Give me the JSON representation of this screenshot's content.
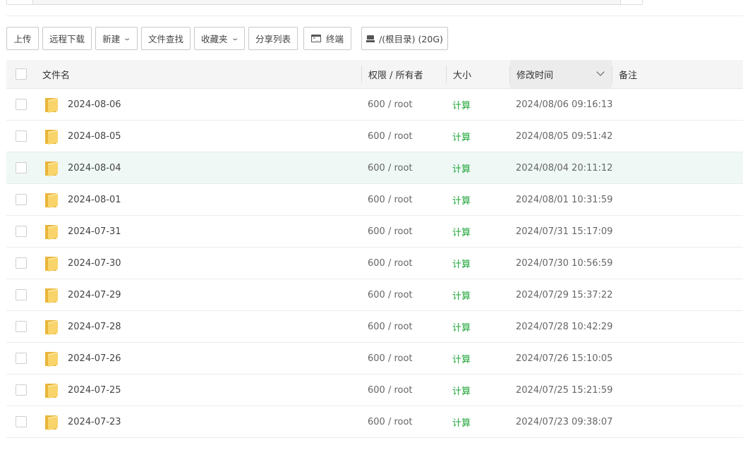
{
  "toolbar": {
    "upload": "上传",
    "remote_download": "远程下载",
    "new": "新建",
    "file_search": "文件查找",
    "favorites": "收藏夹",
    "share_list": "分享列表",
    "terminal": "终端",
    "disk": "/(根目录) (20G)"
  },
  "table": {
    "headers": {
      "name": "文件名",
      "perm_owner": "权限 / 所有者",
      "size": "大小",
      "mtime": "修改时间",
      "remark": "备注"
    },
    "rows": [
      {
        "name": "2024-08-06",
        "perm": "600 / root",
        "size": "计算",
        "mtime": "2024/08/06 09:16:13"
      },
      {
        "name": "2024-08-05",
        "perm": "600 / root",
        "size": "计算",
        "mtime": "2024/08/05 09:51:42"
      },
      {
        "name": "2024-08-04",
        "perm": "600 / root",
        "size": "计算",
        "mtime": "2024/08/04 20:11:12"
      },
      {
        "name": "2024-08-01",
        "perm": "600 / root",
        "size": "计算",
        "mtime": "2024/08/01 10:31:59"
      },
      {
        "name": "2024-07-31",
        "perm": "600 / root",
        "size": "计算",
        "mtime": "2024/07/31 15:17:09"
      },
      {
        "name": "2024-07-30",
        "perm": "600 / root",
        "size": "计算",
        "mtime": "2024/07/30 10:56:59"
      },
      {
        "name": "2024-07-29",
        "perm": "600 / root",
        "size": "计算",
        "mtime": "2024/07/29 15:37:22"
      },
      {
        "name": "2024-07-28",
        "perm": "600 / root",
        "size": "计算",
        "mtime": "2024/07/28 10:42:29"
      },
      {
        "name": "2024-07-26",
        "perm": "600 / root",
        "size": "计算",
        "mtime": "2024/07/26 15:10:05"
      },
      {
        "name": "2024-07-25",
        "perm": "600 / root",
        "size": "计算",
        "mtime": "2024/07/25 15:21:59"
      },
      {
        "name": "2024-07-23",
        "perm": "600 / root",
        "size": "计算",
        "mtime": "2024/07/23 09:38:07"
      }
    ]
  },
  "icons": {
    "folder": "folder-icon",
    "terminal": "terminal-icon",
    "disk": "disk-icon",
    "sort": "chevron-down-icon"
  },
  "colors": {
    "accent_green": "#20a53a",
    "folder_yellow": "#f5c94d",
    "row_highlight": "#eff8f5"
  }
}
